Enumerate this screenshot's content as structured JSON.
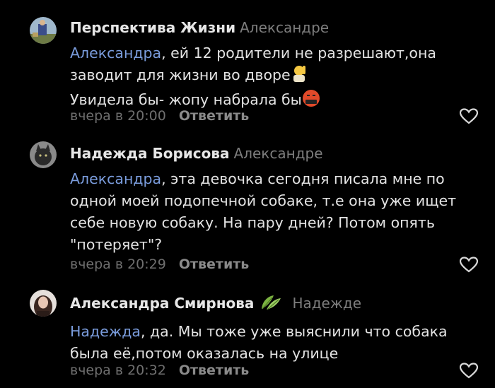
{
  "comments": [
    {
      "author": "Перспектива Жизни",
      "reply_to": "Александре",
      "mention": "Александра",
      "lines": [
        ", ей 12 родители не разрешают,она",
        "заводит для жизни во дворе",
        "Увидела бы- жопу набрала бы"
      ],
      "emoji_1": "person-raising-hand",
      "emoji_2": "angry-face-with-symbols",
      "time": "вчера в 20:00",
      "reply_label": "Ответить"
    },
    {
      "author": "Надежда Борисова",
      "reply_to": "Александре",
      "mention": "Александра",
      "lines": [
        ", эта девочка сегодня писала мне по",
        "одной моей подопечной собаке, т.е она уже ищет",
        "себе новую собаку. На пару дней? Потом опять",
        "\"потеряет\"?"
      ],
      "time": "вчера в 20:29",
      "reply_label": "Ответить"
    },
    {
      "author": "Александра Смирнова",
      "reply_to": "Надежде",
      "mention": "Надежда",
      "lines": [
        ", да. Мы тоже уже выяснили что собака",
        "была её,потом оказалась на улице"
      ],
      "badge": "leaf-icon",
      "time": "вчера в 20:32",
      "reply_label": "Ответить"
    }
  ],
  "colors": {
    "background": "#000000",
    "text": "#e3e3e3",
    "mention": "#7a9cdc",
    "muted": "#7d7d7d"
  }
}
